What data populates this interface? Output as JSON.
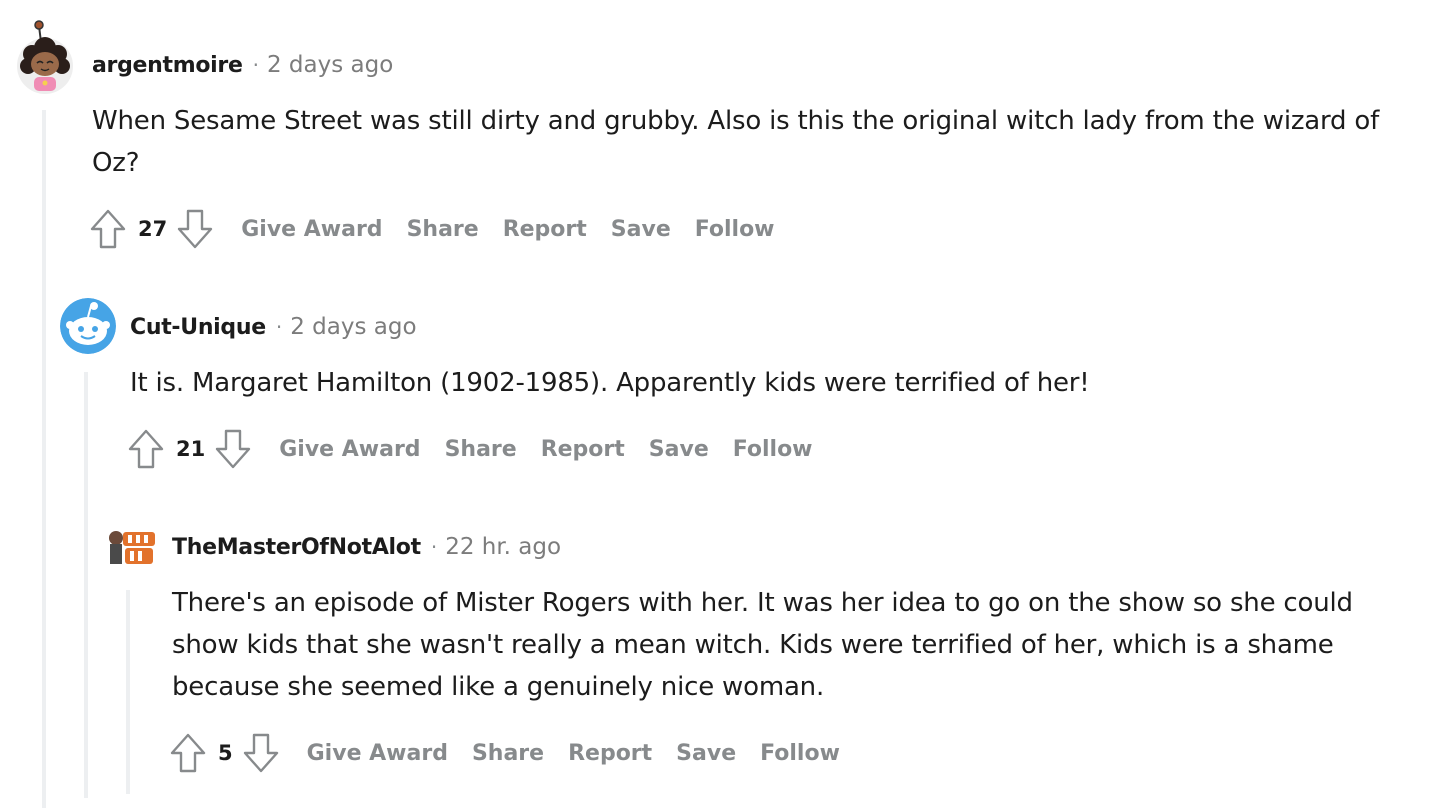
{
  "comments": [
    {
      "author": "argentmoire",
      "separator": "·",
      "time": "2 days ago",
      "body": "When Sesame Street was still dirty and grubby. Also is this the original witch lady from the wizard of Oz?",
      "score": "27",
      "avatar_icon": "snoo-avatar-curly-hair-icon"
    },
    {
      "author": "Cut-Unique",
      "separator": "·",
      "time": "2 days ago",
      "body": "It is. Margaret Hamilton (1902-1985). Apparently kids were terrified of her!",
      "score": "21",
      "avatar_icon": "default-snoo-avatar-icon"
    },
    {
      "author": "TheMasterOfNotAlot",
      "separator": "·",
      "time": "22 hr. ago",
      "body": "There's an episode of Mister Rogers with her. It was her idea to go on the show so she could show kids that she wasn't really a mean witch. Kids were terrified of her, which is a shame because she seemed like a genuinely nice woman.",
      "score": "5",
      "avatar_icon": "orange-logo-avatar-icon"
    }
  ],
  "actions": {
    "give_award": "Give Award",
    "share": "Share",
    "report": "Report",
    "save": "Save",
    "follow": "Follow"
  },
  "colors": {
    "text": "#1c1c1c",
    "meta": "#878a8c",
    "thread_line": "#edeff1",
    "snoo_blue": "#46a4e6",
    "avatar_orange": "#e2722c"
  }
}
